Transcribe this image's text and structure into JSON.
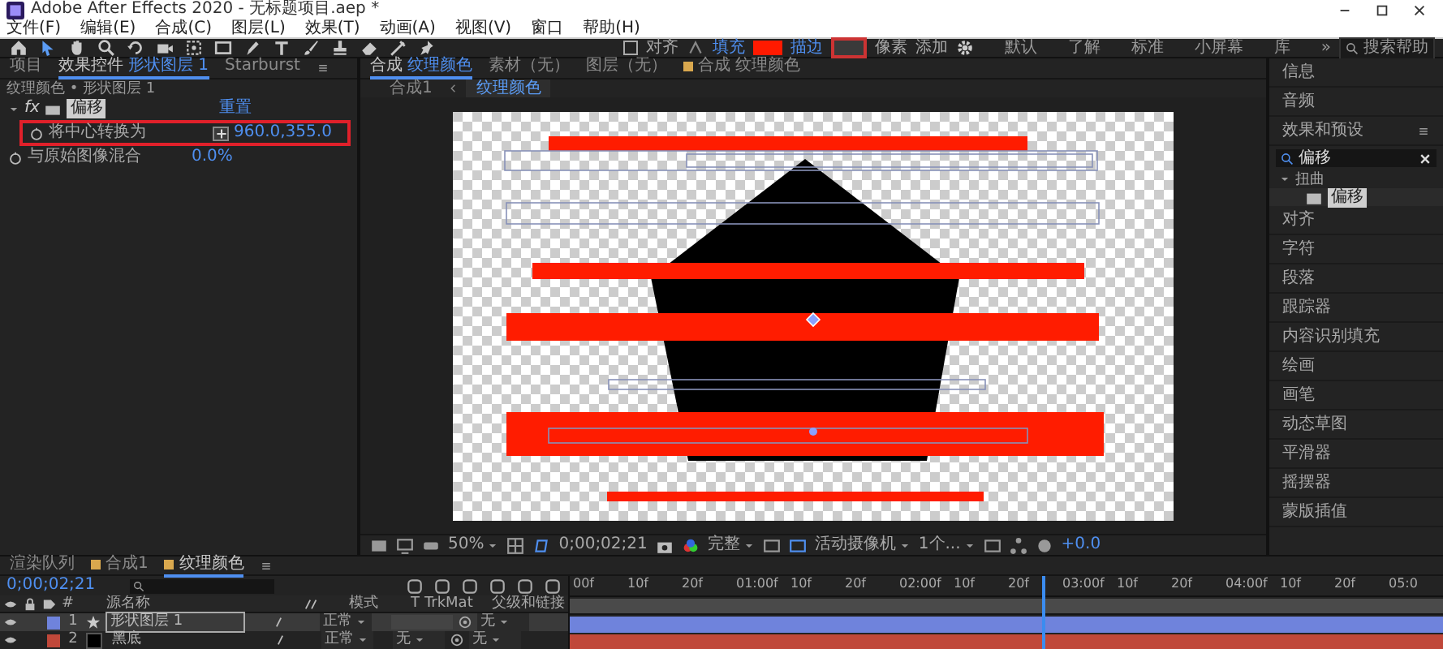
{
  "window": {
    "title": "Adobe After Effects 2020 - 无标题项目.aep *"
  },
  "menu": [
    "文件(F)",
    "编辑(E)",
    "合成(C)",
    "图层(L)",
    "效果(T)",
    "动画(A)",
    "视图(V)",
    "窗口",
    "帮助(H)"
  ],
  "toolbar": {
    "snap": {
      "label": "对齐",
      "checked": false
    },
    "fill_label": "填充",
    "stroke_label": "描边",
    "stroke_width": "像素",
    "add_label": "添加",
    "workspaces": [
      "默认",
      "了解",
      "标准",
      "小屏幕",
      "库"
    ],
    "more": "»",
    "search_help": "搜索帮助"
  },
  "effect_controls": {
    "tabs": [
      {
        "label": "项目",
        "selected": false
      },
      {
        "label": "效果控件",
        "target": "形状图层 1",
        "selected": true
      },
      {
        "label": "Starburst",
        "selected": false
      }
    ],
    "breadcrumb": "纹理颜色 • 形状图层 1",
    "effect": {
      "fx_label": "fx",
      "name": "偏移",
      "reset": "重置",
      "params": [
        {
          "name": "将中心转换为",
          "value": "960.0,355.0",
          "kind": "point",
          "highlighted": true
        },
        {
          "name": "与原始图像混合",
          "value": "0.0%",
          "kind": "number",
          "highlighted": false
        }
      ]
    }
  },
  "composition": {
    "tabs": [
      {
        "label": "合成",
        "target": "纹理颜色",
        "selected": true
      },
      {
        "label": "素材（无）",
        "selected": false
      },
      {
        "label": "图层（无）",
        "selected": false
      }
    ],
    "second_viewer_tab": {
      "label": "合成 纹理颜色"
    },
    "breadcrumb": [
      {
        "label": "合成1",
        "selected": false
      },
      {
        "label": "纹理颜色",
        "selected": true
      }
    ],
    "viewer_bar": {
      "zoom": "50%",
      "time": "0;00;02;21",
      "resolution": "完整",
      "camera": "活动摄像机",
      "views": "1个...",
      "exposure": "+0.0"
    }
  },
  "right_panel": {
    "panels_top": [
      "信息",
      "音频"
    ],
    "effects_presets": {
      "title": "效果和预设",
      "search": "偏移",
      "category": "扭曲",
      "result": "偏移"
    },
    "panels": [
      "对齐",
      "字符",
      "段落",
      "跟踪器",
      "内容识别填充",
      "绘画",
      "画笔",
      "动态草图",
      "平滑器",
      "摇摆器",
      "蒙版插值"
    ]
  },
  "timeline": {
    "tabs": [
      {
        "label": "渲染队列",
        "selected": false
      },
      {
        "label": "合成1",
        "selected": false
      },
      {
        "label": "纹理颜色",
        "selected": true
      }
    ],
    "time": "0;00;02;21",
    "columns": {
      "number": "#",
      "name": "源名称",
      "mode": "模式",
      "t": "T",
      "trkmat": "TrkMat",
      "parent": "父级和链接"
    },
    "layers": [
      {
        "number": "1",
        "name": "形状图层 1",
        "kind": "shape",
        "mode": "正常",
        "parent": "无",
        "color": "#6f83dc",
        "selected": true
      },
      {
        "number": "2",
        "name": "黑底",
        "kind": "solid",
        "mode": "正常",
        "trkmat": "无",
        "parent": "无",
        "color": "#c0483a",
        "selected": false
      }
    ],
    "ruler": [
      "00f",
      "10f",
      "20f",
      "01:00f",
      "10f",
      "20f",
      "02:00f",
      "10f",
      "20f",
      "03:00f",
      "10f",
      "20f",
      "04:00f",
      "10f",
      "20f",
      "05:0"
    ],
    "playhead": {
      "level": 0.54
    }
  }
}
